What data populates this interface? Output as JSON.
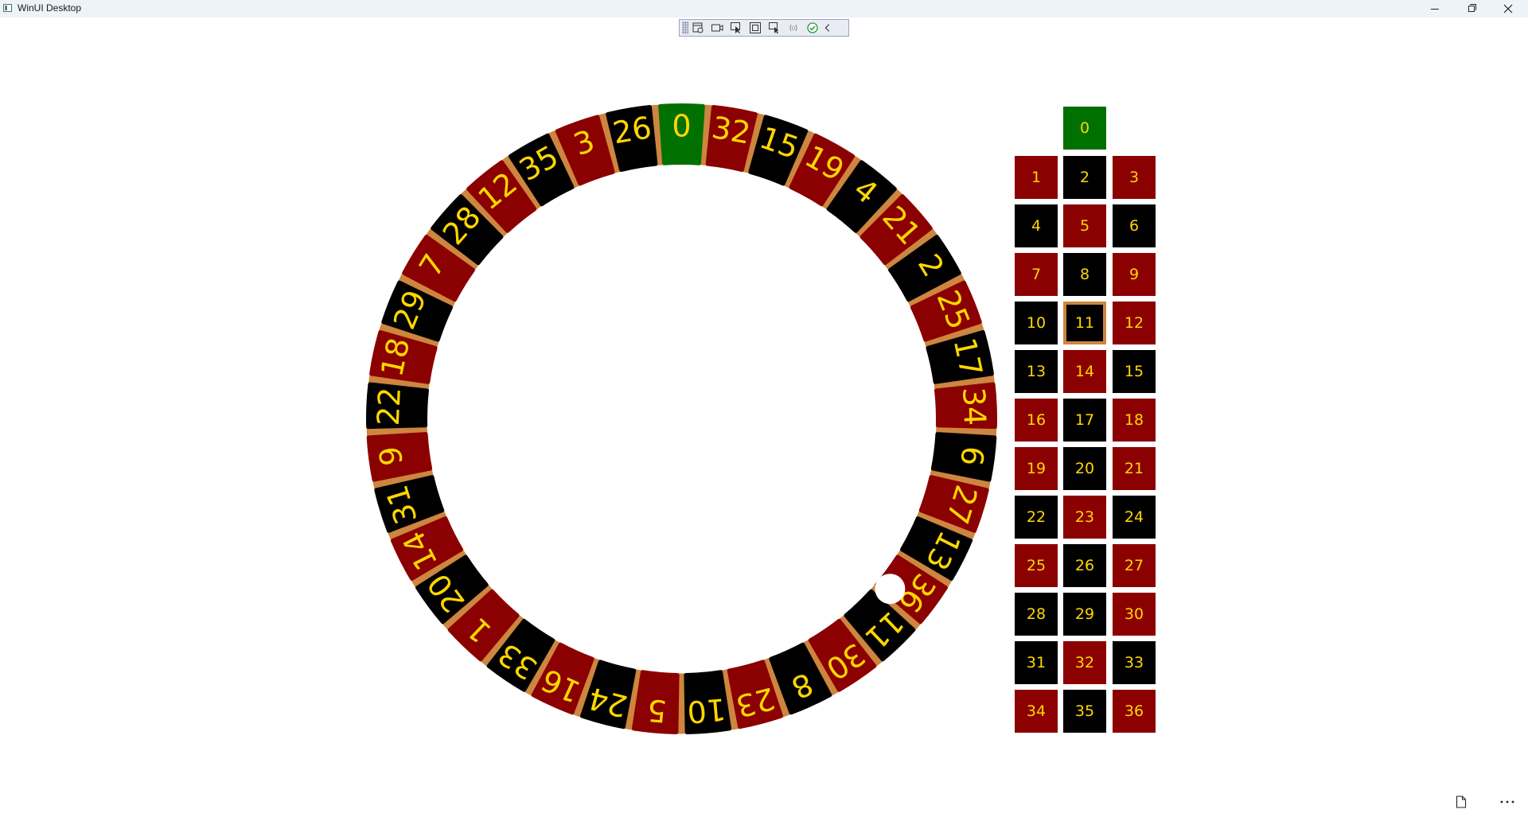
{
  "window": {
    "title": "WinUI Desktop",
    "controls": [
      "minimize",
      "maximize",
      "close"
    ]
  },
  "debug_toolbar": {
    "icons": [
      "toolbar-grip-icon",
      "live-visual-tree-icon",
      "record-icon",
      "select-element-icon",
      "display-layout-adorners-icon",
      "track-focus-icon",
      "binding-failures-icon",
      "hot-reload-ok-icon",
      "collapse-chevron-icon"
    ]
  },
  "wheel": {
    "order": [
      "0",
      "32",
      "15",
      "19",
      "4",
      "21",
      "2",
      "25",
      "17",
      "34",
      "6",
      "27",
      "13",
      "36",
      "11",
      "30",
      "8",
      "23",
      "10",
      "5",
      "24",
      "16",
      "33",
      "1",
      "20",
      "14",
      "31",
      "9",
      "22",
      "18",
      "29",
      "7",
      "28",
      "12",
      "35",
      "3",
      "26"
    ],
    "colors": {
      "red": "#8b0000",
      "black": "#000000",
      "green": "#007000",
      "rim": "#cd853f",
      "text": "#ffd700",
      "ball": "#ffffff"
    },
    "ball_on": "11"
  },
  "board": {
    "zero": "0",
    "rows": [
      [
        "1",
        "2",
        "3"
      ],
      [
        "4",
        "5",
        "6"
      ],
      [
        "7",
        "8",
        "9"
      ],
      [
        "10",
        "11",
        "12"
      ],
      [
        "13",
        "14",
        "15"
      ],
      [
        "16",
        "17",
        "18"
      ],
      [
        "19",
        "20",
        "21"
      ],
      [
        "22",
        "23",
        "24"
      ],
      [
        "25",
        "26",
        "27"
      ],
      [
        "28",
        "29",
        "30"
      ],
      [
        "31",
        "32",
        "33"
      ],
      [
        "34",
        "35",
        "36"
      ]
    ],
    "red_numbers": [
      "1",
      "3",
      "5",
      "7",
      "9",
      "12",
      "14",
      "16",
      "18",
      "19",
      "21",
      "23",
      "25",
      "27",
      "30",
      "32",
      "34",
      "36"
    ],
    "selected": "11"
  },
  "footer": {
    "icons": [
      "document-icon",
      "more-options-icon"
    ]
  }
}
